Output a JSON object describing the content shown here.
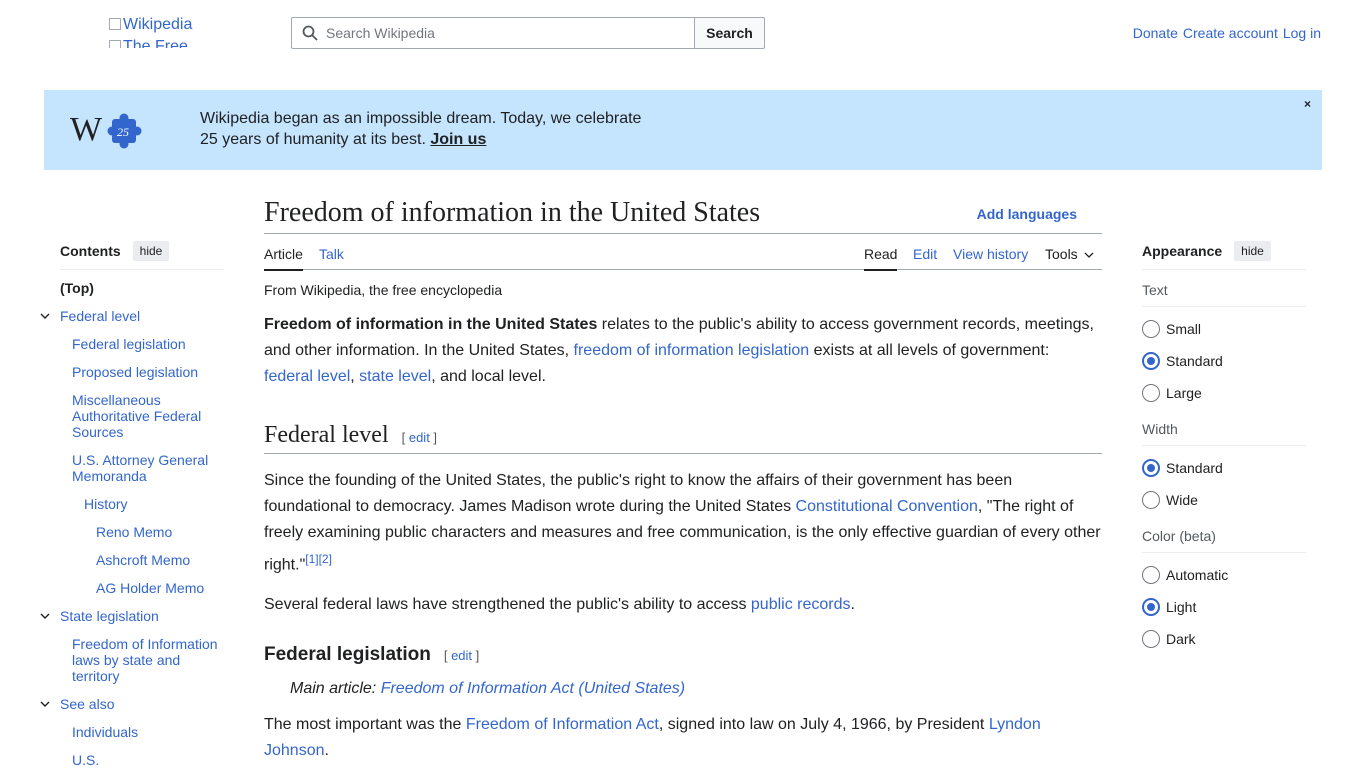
{
  "header": {
    "logo_alt_1": "Wikipedia",
    "logo_alt_2": "The Free",
    "search_placeholder": "Search Wikipedia",
    "search_button": "Search",
    "user_links": [
      "Donate",
      "Create account",
      "Log in"
    ]
  },
  "banner": {
    "line1": "Wikipedia began as an impossible dream. Today, we celebrate",
    "line2_text": "25 years of humanity at its best.",
    "join": "Join us",
    "close": "×",
    "logo_number": "25",
    "logo_letter": "W"
  },
  "toc": {
    "title": "Contents",
    "hide": "hide",
    "items": [
      {
        "label": "(Top)",
        "level": 1
      },
      {
        "label": "Federal level",
        "level": 1
      },
      {
        "label": "Federal legislation",
        "level": 2
      },
      {
        "label": "Proposed legislation",
        "level": 2
      },
      {
        "label": "Miscellaneous Authoritative Federal Sources",
        "level": 2
      },
      {
        "label": "U.S. Attorney General Memoranda",
        "level": 2
      },
      {
        "label": "History",
        "level": 3
      },
      {
        "label": "Reno Memo",
        "level": 4
      },
      {
        "label": "Ashcroft Memo",
        "level": 4
      },
      {
        "label": "AG Holder Memo",
        "level": 4
      },
      {
        "label": "State legislation",
        "level": 1
      },
      {
        "label": "Freedom of Information laws by state and territory",
        "level": 2
      },
      {
        "label": "See also",
        "level": 1
      },
      {
        "label": "Individuals",
        "level": 2
      },
      {
        "label": "U.S.",
        "level": 2
      }
    ]
  },
  "article": {
    "title": "Freedom of information in the United States",
    "add_languages": "Add languages",
    "tabs": {
      "article": "Article",
      "talk": "Talk",
      "read": "Read",
      "edit": "Edit",
      "history": "View history",
      "tools": "Tools"
    },
    "tagline": "From Wikipedia, the free encyclopedia",
    "intro": {
      "bold": "Freedom of information in the United States",
      "t1": " relates to the public's ability to access government records, meetings, and other information. In the United States, ",
      "link1": "freedom of information legislation",
      "t2": " exists at all levels of government: ",
      "link2": "federal level",
      "t3": ", ",
      "link3": "state level",
      "t4": ", and local level."
    },
    "federal_heading": "Federal level",
    "edit_label": "edit",
    "federal_p1": {
      "t1": "Since the founding of the United States, the public's right to know the affairs of their government has been foundational to democracy. James Madison wrote during the United States ",
      "link": "Constitutional Convention",
      "t2": ", \"The right of freely examining public characters and measures and free communication, is the only effective guardian of every other right.\"",
      "ref1": "[1]",
      "ref2": "[2]"
    },
    "federal_p2": {
      "t1": "Several federal laws have strengthened the public's ability to access ",
      "link": "public records",
      "t2": "."
    },
    "legislation_heading": "Federal legislation",
    "hatnote": {
      "label": "Main article: ",
      "link": "Freedom of Information Act (United States)"
    },
    "legislation_p1": {
      "t1": "The most important was the ",
      "link1": "Freedom of Information Act",
      "t2": ", signed into law on July 4, 1966, by President ",
      "link2": "Lyndon Johnson",
      "t3": "."
    }
  },
  "appearance": {
    "title": "Appearance",
    "hide": "hide",
    "text_label": "Text",
    "text_options": [
      "Small",
      "Standard",
      "Large"
    ],
    "width_label": "Width",
    "width_options": [
      "Standard",
      "Wide"
    ],
    "color_label": "Color (beta)",
    "color_options": [
      "Automatic",
      "Light",
      "Dark"
    ]
  }
}
